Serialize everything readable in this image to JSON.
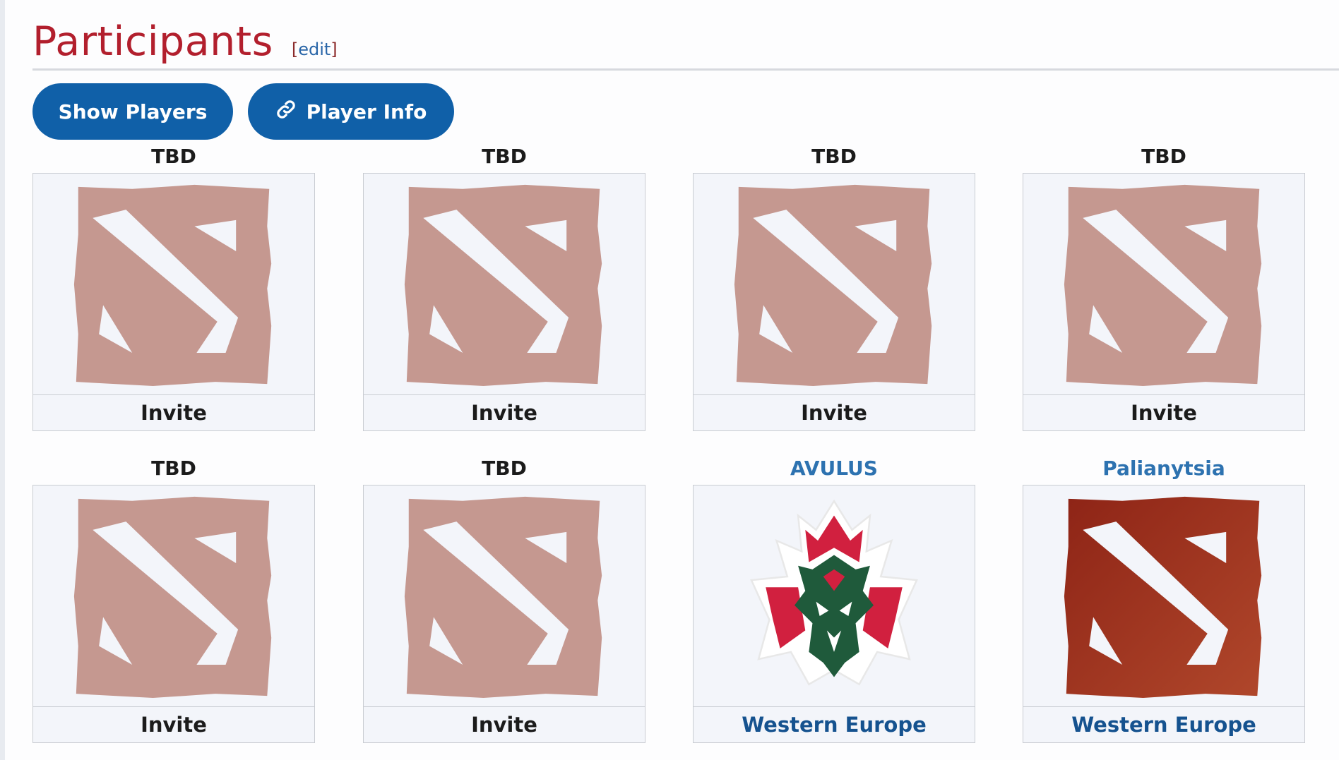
{
  "section": {
    "title": "Participants",
    "edit_label": "edit"
  },
  "buttons": {
    "show_players": "Show Players",
    "player_info": "Player Info"
  },
  "colors": {
    "heading": "#b21f2d",
    "button": "#1060a8",
    "placeholder_logo": "#c59890",
    "team_logo": "#a23a22"
  },
  "participants": [
    {
      "name": "TBD",
      "logo": "dota-placeholder-icon",
      "footer": "Invite"
    },
    {
      "name": "TBD",
      "logo": "dota-placeholder-icon",
      "footer": "Invite"
    },
    {
      "name": "TBD",
      "logo": "dota-placeholder-icon",
      "footer": "Invite"
    },
    {
      "name": "TBD",
      "logo": "dota-placeholder-icon",
      "footer": "Invite"
    },
    {
      "name": "TBD",
      "logo": "dota-placeholder-icon",
      "footer": "Invite"
    },
    {
      "name": "TBD",
      "logo": "dota-placeholder-icon",
      "footer": "Invite"
    },
    {
      "name": "AVULUS",
      "logo": "avulus-dragon-icon",
      "footer": "Western Europe"
    },
    {
      "name": "Palianytsia",
      "logo": "dota-logo-icon",
      "footer": "Western Europe"
    }
  ]
}
